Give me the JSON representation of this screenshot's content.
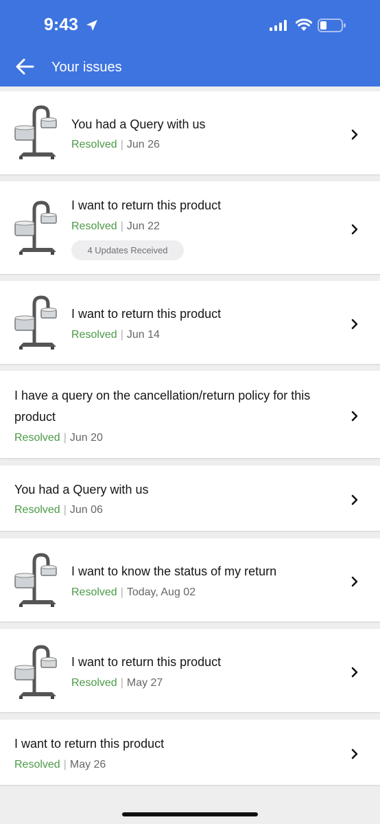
{
  "status_bar": {
    "time": "9:43"
  },
  "header": {
    "title": "Your issues"
  },
  "colors": {
    "header": "#3e74e0",
    "resolved": "#4a9a45"
  },
  "issues": [
    {
      "title": "You had a Query with us",
      "status": "Resolved",
      "date": "Jun 26",
      "has_image": true
    },
    {
      "title": "I want to return this product",
      "status": "Resolved",
      "date": "Jun 22",
      "has_image": true,
      "badge": "4 Updates Received"
    },
    {
      "title": "I want to return this product",
      "status": "Resolved",
      "date": "Jun 14",
      "has_image": true
    },
    {
      "title": "I have a query on the cancellation/return policy for this product",
      "status": "Resolved",
      "date": "Jun 20",
      "has_image": false
    },
    {
      "title": "You had a Query with us",
      "status": "Resolved",
      "date": "Jun 06",
      "has_image": false
    },
    {
      "title": "I want to know the status of my return",
      "status": "Resolved",
      "date": "Today, Aug 02",
      "has_image": true
    },
    {
      "title": "I want to return this product",
      "status": "Resolved",
      "date": "May 27",
      "has_image": true
    },
    {
      "title": "I want to return this product",
      "status": "Resolved",
      "date": "May 26",
      "has_image": false
    }
  ]
}
